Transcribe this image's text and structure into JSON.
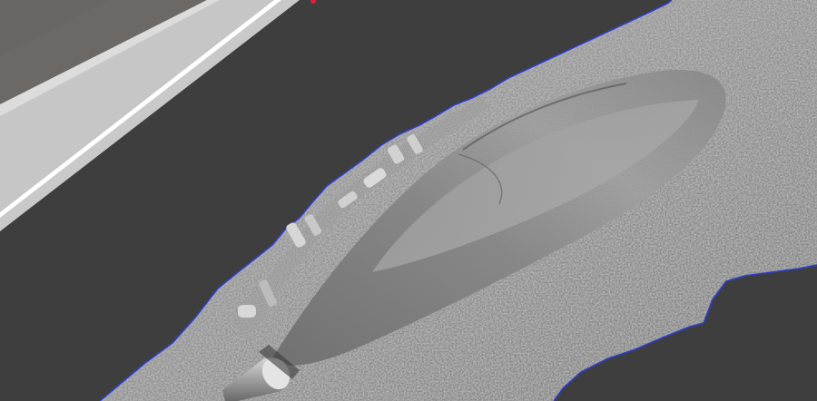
{
  "viewport": {
    "background": "#3e3e3e",
    "mesh_color": "#9a9a9a",
    "boundary_color": "#2f3fd0",
    "plane_color": "#c8c8c8",
    "plane_inner_color": "#6d6966",
    "marker_color": "#e0203a"
  },
  "scene": {
    "objects": [
      {
        "name": "reference-plane",
        "type": "plane"
      },
      {
        "name": "terrain-mesh",
        "type": "scanned-surface"
      },
      {
        "name": "mound",
        "type": "surface-feature"
      },
      {
        "name": "debris-ridge",
        "type": "surface-feature"
      },
      {
        "name": "cylinder-object",
        "type": "surface-feature"
      }
    ]
  }
}
